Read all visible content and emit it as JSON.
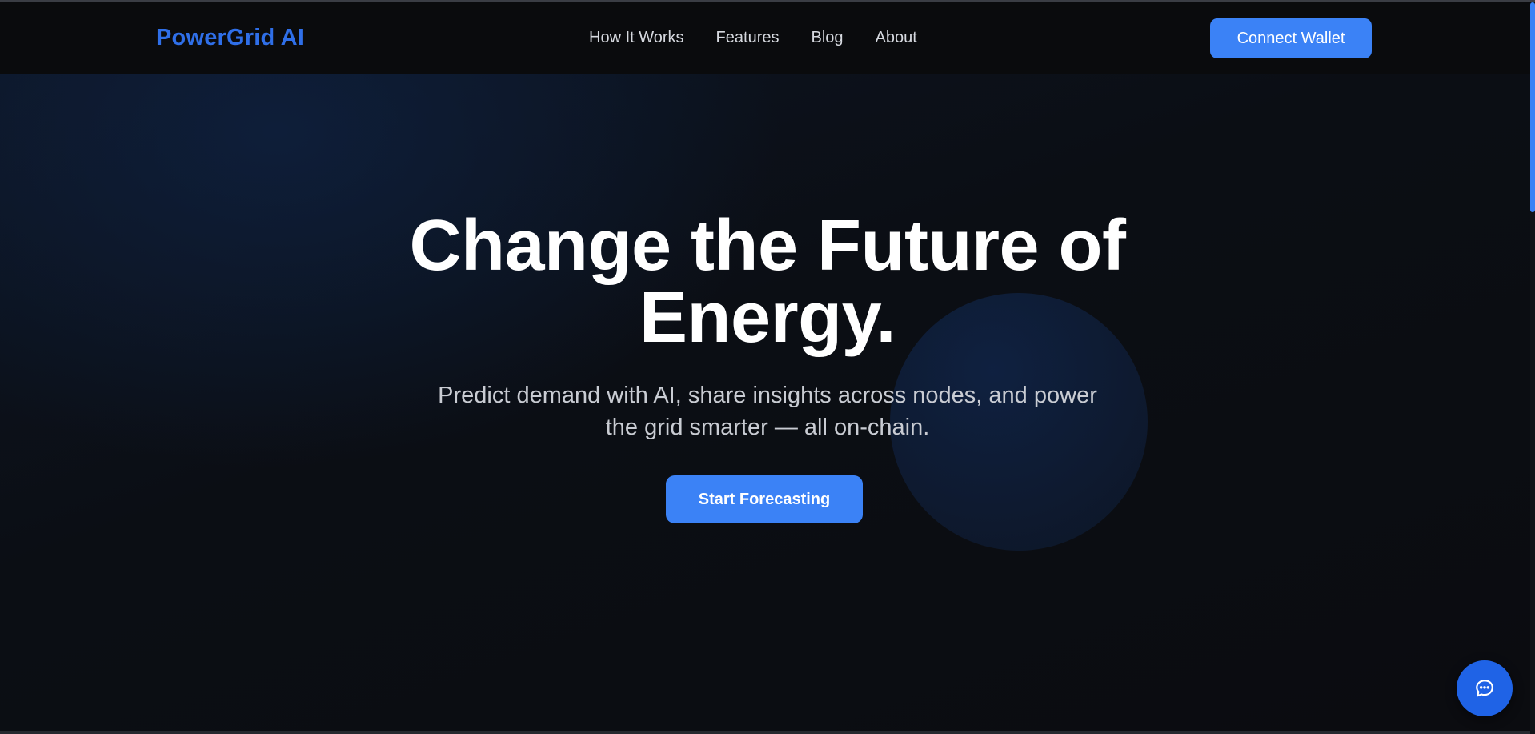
{
  "header": {
    "brand": "PowerGrid AI",
    "nav": [
      {
        "label": "How It Works"
      },
      {
        "label": "Features"
      },
      {
        "label": "Blog"
      },
      {
        "label": "About"
      }
    ],
    "connect_label": "Connect Wallet"
  },
  "hero": {
    "title_line1": "Change the Future of",
    "title_line2": "Energy.",
    "subtitle_line1": "Predict demand with AI, share insights across nodes, and power",
    "subtitle_line2": "the grid smarter — all on-chain.",
    "cta_label": "Start Forecasting"
  },
  "widgets": {
    "chat_icon": "chat-bubble-icon"
  },
  "colors": {
    "accent": "#3b82f6",
    "brand": "#2f6fe8",
    "background": "#0b0d11"
  }
}
